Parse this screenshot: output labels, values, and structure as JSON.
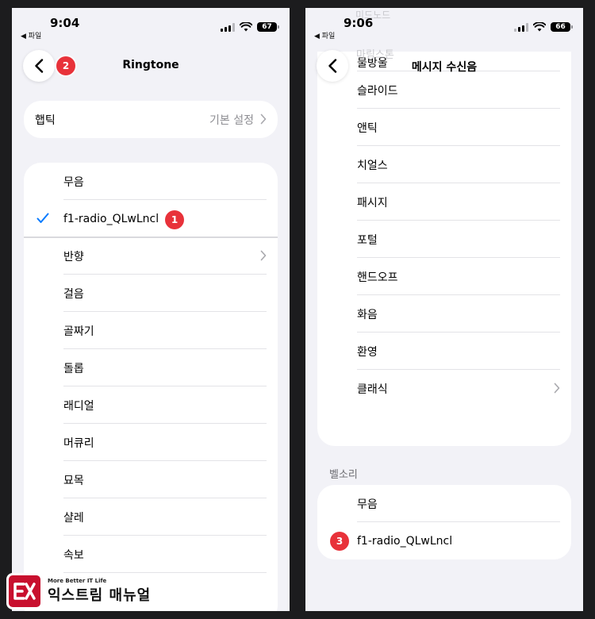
{
  "left": {
    "status": {
      "time": "9:04",
      "back_app": "◀ 파일",
      "battery": "67"
    },
    "nav": {
      "title": "Ringtone"
    },
    "haptic": {
      "label": "햅틱",
      "value": "기본 설정"
    },
    "list": [
      {
        "label": "무음",
        "checked": false,
        "chevron": false
      },
      {
        "label": "f1-radio_QLwLncl",
        "checked": true,
        "chevron": false
      },
      {
        "label": "반향",
        "checked": false,
        "chevron": true
      },
      {
        "label": "걸음",
        "checked": false,
        "chevron": false
      },
      {
        "label": "골짜기",
        "checked": false,
        "chevron": false
      },
      {
        "label": "돌롭",
        "checked": false,
        "chevron": false
      },
      {
        "label": "래디얼",
        "checked": false,
        "chevron": false
      },
      {
        "label": "머큐리",
        "checked": false,
        "chevron": false
      },
      {
        "label": "묘목",
        "checked": false,
        "chevron": false
      },
      {
        "label": "샬레",
        "checked": false,
        "chevron": false
      },
      {
        "label": "속보",
        "checked": false,
        "chevron": false
      }
    ],
    "badges": [
      "1",
      "2"
    ]
  },
  "right": {
    "status": {
      "time": "9:06",
      "back_app": "◀ 파일",
      "battery": "66"
    },
    "nav": {
      "title": "메시지 수신음"
    },
    "faded_above": [
      "미드노드",
      "마림스톤"
    ],
    "list": [
      {
        "label": "물방울",
        "chevron": false
      },
      {
        "label": "슬라이드",
        "chevron": false
      },
      {
        "label": "앤틱",
        "chevron": false
      },
      {
        "label": "치얼스",
        "chevron": false
      },
      {
        "label": "패시지",
        "chevron": false
      },
      {
        "label": "포털",
        "chevron": false
      },
      {
        "label": "핸드오프",
        "chevron": false
      },
      {
        "label": "화음",
        "chevron": false
      },
      {
        "label": "환영",
        "chevron": false
      },
      {
        "label": "클래식",
        "chevron": true
      }
    ],
    "section_header": "벨소리",
    "ringtones": [
      {
        "label": "무음"
      },
      {
        "label": "f1-radio_QLwLncl"
      }
    ],
    "badges": [
      "3"
    ]
  },
  "watermark": {
    "tagline": "More Better IT Life",
    "name": "익스트림 매뉴얼"
  },
  "colors": {
    "accent_blue": "#007aff",
    "badge_red": "#e8323a",
    "logo_red": "#c8102e",
    "background": "#f2f2f7"
  }
}
